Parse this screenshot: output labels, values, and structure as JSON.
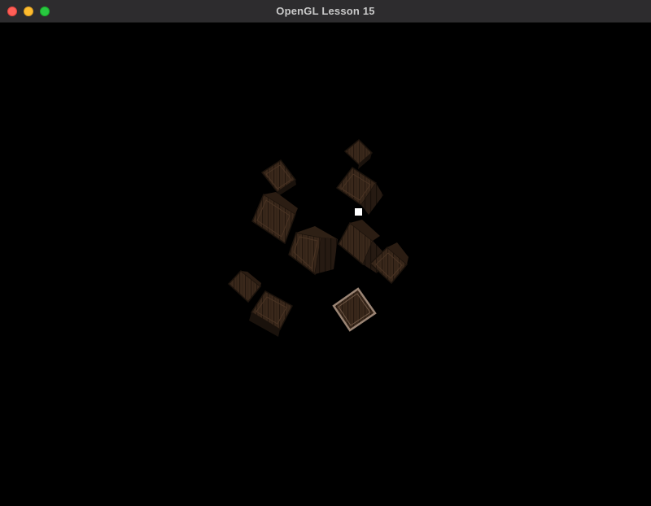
{
  "window": {
    "title": "OpenGL Lesson 15",
    "controls": {
      "close_color": "#ff5f57",
      "minimize_color": "#febc2e",
      "zoom_color": "#28c840"
    }
  },
  "scene": {
    "background": "#000000",
    "crate_colors": {
      "wood_dark": "#2a1d14",
      "wood_mid": "#3f2b1d",
      "wood_light": "#5a3d27",
      "frame_highlight": "#8a7260"
    },
    "light_marker_color": "#ffffff"
  }
}
